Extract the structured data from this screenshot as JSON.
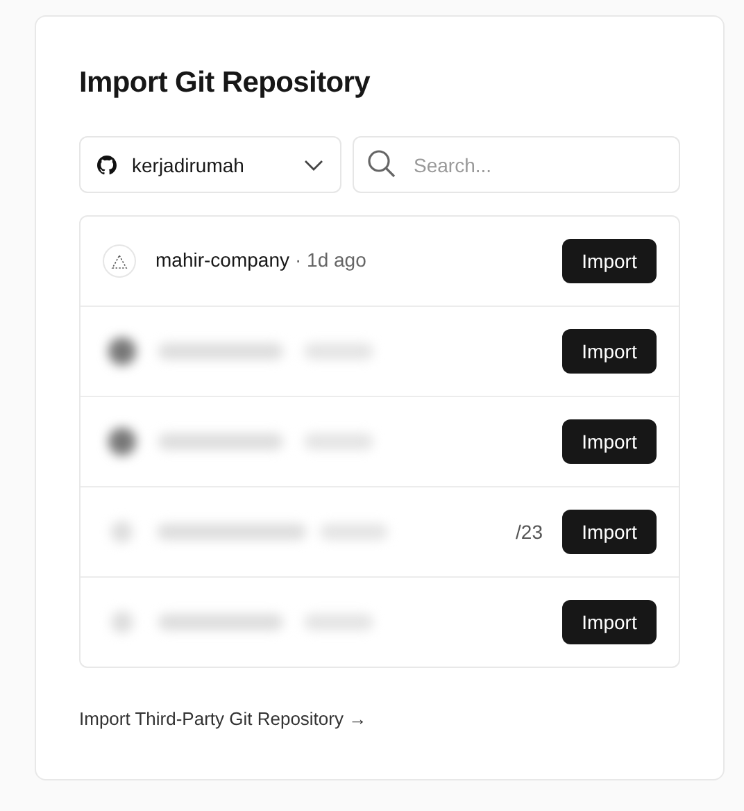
{
  "title": "Import Git Repository",
  "account_select": {
    "value": "kerjadirumah"
  },
  "search": {
    "placeholder": "Search..."
  },
  "repositories": [
    {
      "kind": "repo",
      "name": "mahir-company",
      "age": "· 1d ago",
      "button": "Import"
    },
    {
      "kind": "blurred",
      "button": "Import"
    },
    {
      "kind": "blurred",
      "button": "Import"
    },
    {
      "kind": "blurred",
      "visible_text": "/23",
      "button": "Import"
    },
    {
      "kind": "blurred",
      "button": "Import"
    }
  ],
  "third_party_link": "Import Third-Party Git Repository →"
}
